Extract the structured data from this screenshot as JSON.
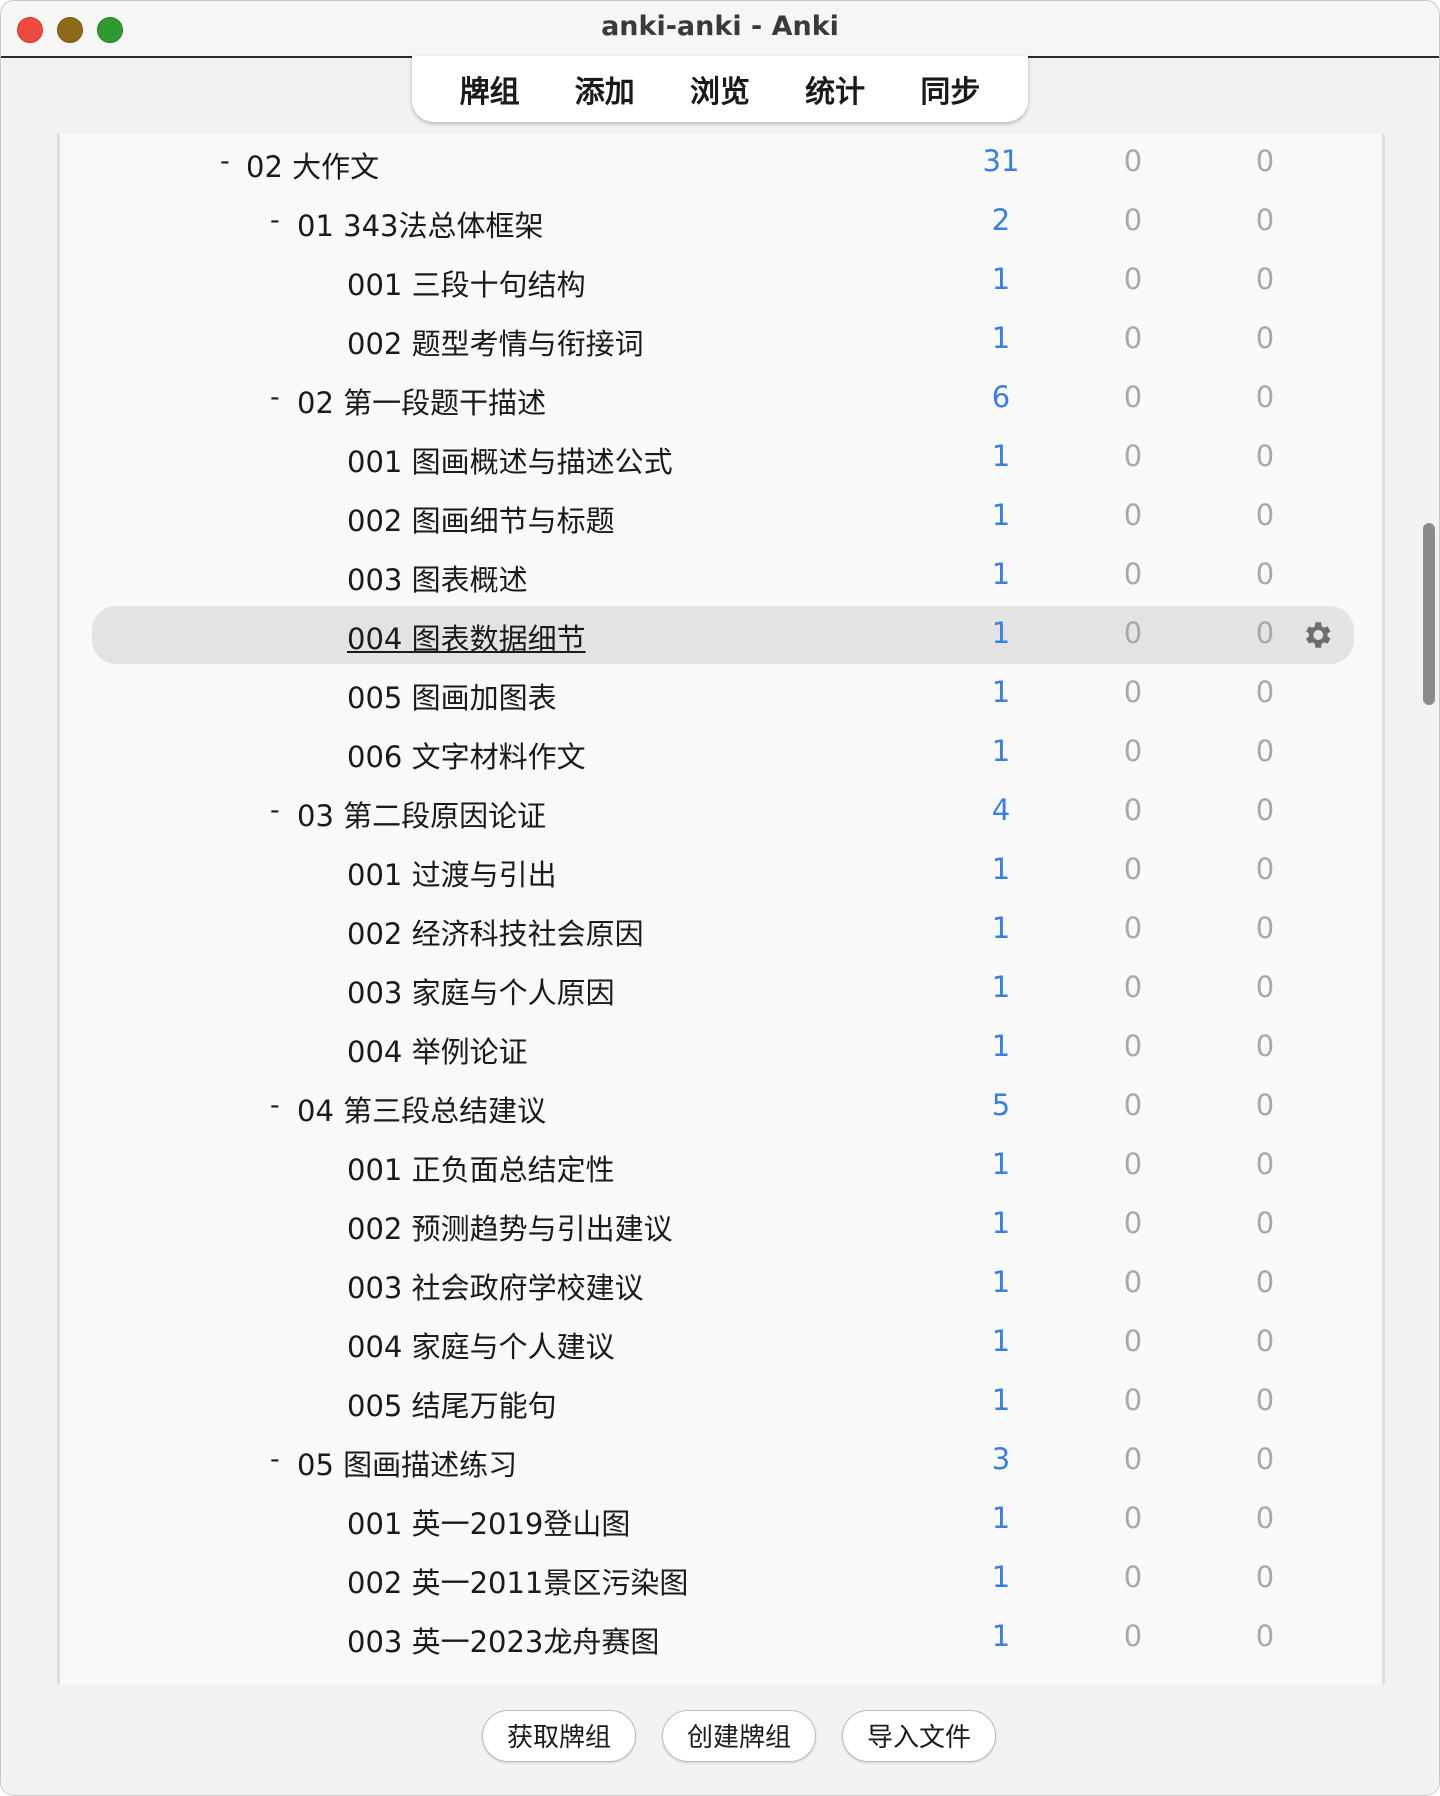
{
  "window": {
    "title": "anki-anki - Anki"
  },
  "toolbar": {
    "items": [
      "牌组",
      "添加",
      "浏览",
      "统计",
      "同步"
    ]
  },
  "decks": [
    {
      "name": "02 大作文",
      "level": 0,
      "collapsible": true,
      "new": "31",
      "learn": "0",
      "due": "0"
    },
    {
      "name": "01 343法总体框架",
      "level": 1,
      "collapsible": true,
      "new": "2",
      "learn": "0",
      "due": "0"
    },
    {
      "name": "001 三段十句结构",
      "level": 2,
      "collapsible": false,
      "new": "1",
      "learn": "0",
      "due": "0"
    },
    {
      "name": "002 题型考情与衔接词",
      "level": 2,
      "collapsible": false,
      "new": "1",
      "learn": "0",
      "due": "0"
    },
    {
      "name": "02 第一段题干描述",
      "level": 1,
      "collapsible": true,
      "new": "6",
      "learn": "0",
      "due": "0"
    },
    {
      "name": "001 图画概述与描述公式",
      "level": 2,
      "collapsible": false,
      "new": "1",
      "learn": "0",
      "due": "0"
    },
    {
      "name": "002 图画细节与标题",
      "level": 2,
      "collapsible": false,
      "new": "1",
      "learn": "0",
      "due": "0"
    },
    {
      "name": "003 图表概述",
      "level": 2,
      "collapsible": false,
      "new": "1",
      "learn": "0",
      "due": "0"
    },
    {
      "name": "004 图表数据细节",
      "level": 2,
      "collapsible": false,
      "new": "1",
      "learn": "0",
      "due": "0",
      "selected": true
    },
    {
      "name": "005 图画加图表",
      "level": 2,
      "collapsible": false,
      "new": "1",
      "learn": "0",
      "due": "0"
    },
    {
      "name": "006 文字材料作文",
      "level": 2,
      "collapsible": false,
      "new": "1",
      "learn": "0",
      "due": "0"
    },
    {
      "name": "03 第二段原因论证",
      "level": 1,
      "collapsible": true,
      "new": "4",
      "learn": "0",
      "due": "0"
    },
    {
      "name": "001 过渡与引出",
      "level": 2,
      "collapsible": false,
      "new": "1",
      "learn": "0",
      "due": "0"
    },
    {
      "name": "002 经济科技社会原因",
      "level": 2,
      "collapsible": false,
      "new": "1",
      "learn": "0",
      "due": "0"
    },
    {
      "name": "003 家庭与个人原因",
      "level": 2,
      "collapsible": false,
      "new": "1",
      "learn": "0",
      "due": "0"
    },
    {
      "name": "004 举例论证",
      "level": 2,
      "collapsible": false,
      "new": "1",
      "learn": "0",
      "due": "0"
    },
    {
      "name": "04 第三段总结建议",
      "level": 1,
      "collapsible": true,
      "new": "5",
      "learn": "0",
      "due": "0"
    },
    {
      "name": "001 正负面总结定性",
      "level": 2,
      "collapsible": false,
      "new": "1",
      "learn": "0",
      "due": "0"
    },
    {
      "name": "002 预测趋势与引出建议",
      "level": 2,
      "collapsible": false,
      "new": "1",
      "learn": "0",
      "due": "0"
    },
    {
      "name": "003 社会政府学校建议",
      "level": 2,
      "collapsible": false,
      "new": "1",
      "learn": "0",
      "due": "0"
    },
    {
      "name": "004 家庭与个人建议",
      "level": 2,
      "collapsible": false,
      "new": "1",
      "learn": "0",
      "due": "0"
    },
    {
      "name": "005 结尾万能句",
      "level": 2,
      "collapsible": false,
      "new": "1",
      "learn": "0",
      "due": "0"
    },
    {
      "name": "05 图画描述练习",
      "level": 1,
      "collapsible": true,
      "new": "3",
      "learn": "0",
      "due": "0"
    },
    {
      "name": "001 英一2019登山图",
      "level": 2,
      "collapsible": false,
      "new": "1",
      "learn": "0",
      "due": "0"
    },
    {
      "name": "002 英一2011景区污染图",
      "level": 2,
      "collapsible": false,
      "new": "1",
      "learn": "0",
      "due": "0"
    },
    {
      "name": "003 英一2023龙舟赛图",
      "level": 2,
      "collapsible": false,
      "new": "1",
      "learn": "0",
      "due": "0"
    }
  ],
  "collapse_symbol": "-",
  "gear_icon": "gear-icon",
  "bottom": {
    "buttons": [
      "获取牌组",
      "创建牌组",
      "导入文件"
    ]
  },
  "colors": {
    "new": "#3a7fdb",
    "zero": "#a8a8a8",
    "selected_row": "#e3e3e3"
  }
}
